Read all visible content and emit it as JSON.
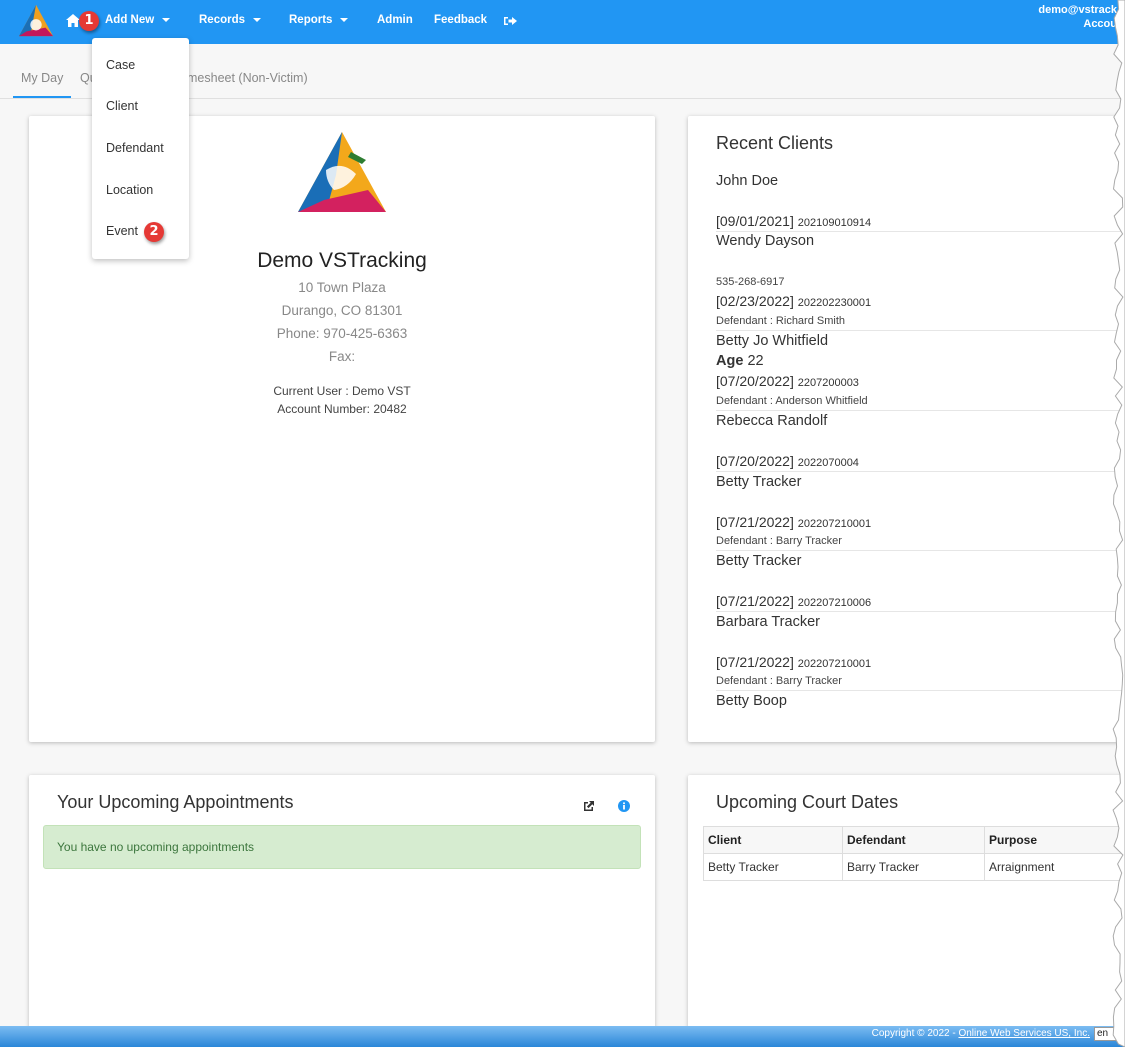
{
  "nav": {
    "items": [
      {
        "label": "Add New",
        "has_caret": true
      },
      {
        "label": "Records",
        "has_caret": true
      },
      {
        "label": "Reports",
        "has_caret": true
      },
      {
        "label": "Admin",
        "has_caret": false
      },
      {
        "label": "Feedback",
        "has_caret": false
      }
    ],
    "icons": {
      "home": "home-icon",
      "logout": "sign-out-icon"
    },
    "user_email": "demo@vstrack",
    "account_link": "Accou"
  },
  "badges": {
    "step1": "1",
    "step2": "2"
  },
  "tabs": [
    {
      "label": "My Day",
      "active": true
    },
    {
      "label": "Qu",
      "active": false
    },
    {
      "label": "mesheet (Non-Victim)",
      "active": false
    }
  ],
  "add_new_menu": {
    "items": [
      "Case",
      "Client",
      "Defendant",
      "Location",
      "Event"
    ]
  },
  "org": {
    "name": "Demo VSTracking",
    "address1": "10 Town Plaza",
    "address2": "Durango, CO 81301",
    "phone": "Phone: 970-425-6363",
    "fax": "Fax:",
    "current_user": "Current User : Demo VST",
    "account_number": "Account Number: 20482"
  },
  "recent_clients": {
    "title": "Recent Clients",
    "entries": [
      {
        "name": "John Doe",
        "date": "[09/01/2021]",
        "case_no": "202109010914"
      },
      {
        "name": "Wendy Dayson",
        "phone": "535-268-6917",
        "date": "[02/23/2022]",
        "case_no": "202202230001",
        "defendant": "Defendant : Richard Smith"
      },
      {
        "name": "Betty Jo Whitfield",
        "age_label": "Age",
        "age": "22",
        "date": "[07/20/2022]",
        "case_no": "2207200003",
        "defendant": "Defendant : Anderson Whitfield"
      },
      {
        "name": "Rebecca Randolf",
        "date": "[07/20/2022]",
        "case_no": "2022070004"
      },
      {
        "name": "Betty Tracker",
        "date": "[07/21/2022]",
        "case_no": "202207210001",
        "defendant": "Defendant : Barry Tracker"
      },
      {
        "name": "Betty Tracker",
        "date": "[07/21/2022]",
        "case_no": "202207210006"
      },
      {
        "name": "Barbara Tracker",
        "date": "[07/21/2022]",
        "case_no": "202207210001",
        "defendant": "Defendant : Barry Tracker"
      },
      {
        "name": "Betty Boop"
      }
    ]
  },
  "appointments": {
    "title": "Your Upcoming Appointments",
    "empty_message": "You have no upcoming appointments",
    "icons": {
      "open": "external-link-icon",
      "info": "info-icon"
    },
    "colors": {
      "alert_bg": "#d6ecd0",
      "alert_text": "#3c763d",
      "info": "#2196f3"
    }
  },
  "court_dates": {
    "title": "Upcoming Court Dates",
    "columns": [
      "Client",
      "Defendant",
      "Purpose"
    ],
    "rows": [
      [
        "Betty Tracker",
        "Barry Tracker",
        "Arraignment"
      ]
    ]
  },
  "footer": {
    "copyright_prefix": "Copyright © 2022 - ",
    "company_link": "Online Web Services US, Inc.",
    "language": "en"
  },
  "colors": {
    "brand_blue": "#2196f3",
    "badge_red": "#e53935"
  }
}
